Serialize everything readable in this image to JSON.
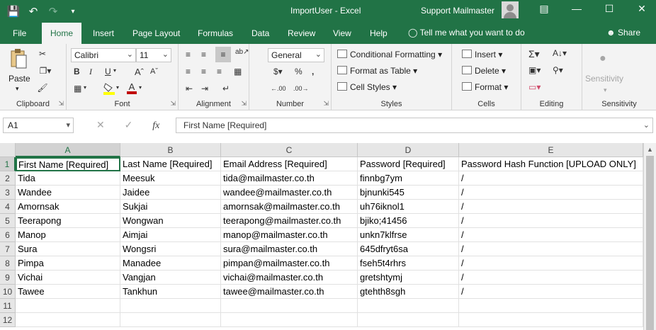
{
  "titlebar": {
    "filename": "ImportUser",
    "separator": "-",
    "app": "Excel",
    "user": "Support Mailmaster",
    "icons": [
      "save-icon",
      "undo-icon",
      "redo-icon",
      "customize-qat-icon",
      "ribbon-display-icon",
      "minimize-icon",
      "maximize-icon",
      "close-icon"
    ]
  },
  "tabs": [
    "File",
    "Home",
    "Insert",
    "Page Layout",
    "Formulas",
    "Data",
    "Review",
    "View",
    "Help"
  ],
  "active_tab": "Home",
  "tellme": "Tell me what you want to do",
  "share": "Share",
  "ribbon": {
    "clipboard": {
      "label": "Clipboard",
      "paste": "Paste"
    },
    "font": {
      "label": "Font",
      "name": "Calibri",
      "size": "11",
      "font_color": "#c00000",
      "highlight_color": "#ffff00"
    },
    "alignment": {
      "label": "Alignment"
    },
    "number": {
      "label": "Number",
      "format": "General"
    },
    "styles": {
      "label": "Styles",
      "conditional": "Conditional Formatting",
      "format_table": "Format as Table",
      "cell_styles": "Cell Styles"
    },
    "cells": {
      "label": "Cells",
      "insert": "Insert",
      "delete": "Delete",
      "format": "Format"
    },
    "editing": {
      "label": "Editing"
    },
    "sensitivity": {
      "label": "Sensitivity",
      "button": "Sensitivity"
    }
  },
  "formula_bar": {
    "name_box": "A1",
    "fx": "fx",
    "content": "First Name [Required]"
  },
  "sheet": {
    "columns": [
      "A",
      "B",
      "C",
      "D",
      "E"
    ],
    "selected_column": "A",
    "selected_row": "1",
    "rows": [
      [
        "First Name [Required]",
        "Last Name [Required]",
        "Email Address [Required]",
        "Password [Required]",
        "Password Hash Function [UPLOAD ONLY]"
      ],
      [
        "Tida",
        "Meesuk",
        "tida@mailmaster.co.th",
        "finnbg7ym",
        "/"
      ],
      [
        "Wandee",
        "Jaidee",
        "wandee@mailmaster.co.th",
        "bjnunki545",
        "/"
      ],
      [
        "Amornsak",
        "Sukjai",
        "amornsak@mailmaster.co.th",
        "uh76iknol1",
        "/"
      ],
      [
        "Teerapong",
        "Wongwan",
        "teerapong@mailmaster.co.th",
        "bjiko;41456",
        "/"
      ],
      [
        "Manop",
        "Aimjai",
        "manop@mailmaster.co.th",
        "unkn7klfrse",
        "/"
      ],
      [
        "Sura",
        "Wongsri",
        "sura@mailmaster.co.th",
        "645dfryt6sa",
        "/"
      ],
      [
        "Pimpa",
        "Manadee",
        "pimpan@mailmaster.co.th",
        "fseh5t4rhrs",
        "/"
      ],
      [
        "Vichai",
        "Vangjan",
        "vichai@mailmaster.co.th",
        "gretshtymj",
        "/"
      ],
      [
        "Tawee",
        "Tankhun",
        "tawee@mailmaster.co.th",
        "gtehth8sgh",
        "/"
      ],
      [
        "",
        "",
        "",
        "",
        ""
      ],
      [
        "",
        "",
        "",
        "",
        ""
      ]
    ]
  }
}
